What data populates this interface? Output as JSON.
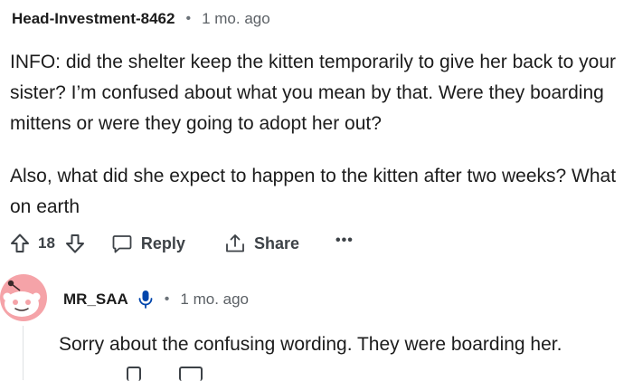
{
  "comment": {
    "username": "Head-Investment-8462",
    "separator": "•",
    "time": "1 mo. ago",
    "paragraphs": [
      "INFO: did the shelter keep the kitten temporarily to give her back to your sister? I’m confused about what you mean by that. Were they boarding mittens or were they going to adopt her out?",
      "Also, what did she expect to happen to the kitten after two weeks? What on earth"
    ],
    "votes": "18",
    "reply_label": "Reply",
    "share_label": "Share",
    "more_label": "•••"
  },
  "reply": {
    "username": "MR_SAA",
    "separator": "•",
    "time": "1 mo. ago",
    "text": "Sorry about the confusing wording. They were boarding her."
  },
  "icons": {
    "upvote": "arrow-up-icon",
    "downvote": "arrow-down-icon",
    "reply": "speech-bubble-icon",
    "share": "share-icon",
    "mic": "microphone-icon",
    "avatar": "reddit-snoo-icon"
  },
  "colors": {
    "text": "#1c1c1c",
    "meta": "#5c6166",
    "avatar_bg": "#f5a3a8",
    "mic": "#0045ac"
  }
}
